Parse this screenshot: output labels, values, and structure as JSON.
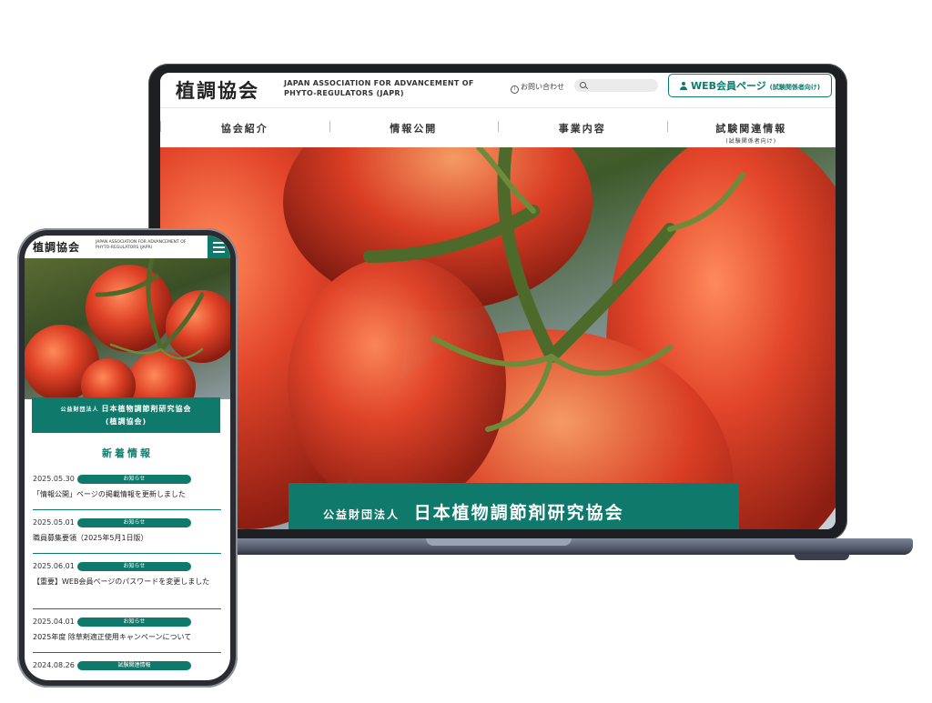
{
  "colors": {
    "accent": "#0f7a6c",
    "laptop_frame": "#1e1f22",
    "laptop_base": "#4a5162"
  },
  "desktop": {
    "logo_jp": "植調協会",
    "logo_en_line1": "JAPAN ASSOCIATION FOR ADVANCEMENT OF",
    "logo_en_line2": "PHYTO-REGULATORS (JAPR)",
    "contact_label": "お問い合わせ",
    "contact_icon": "info-circle-icon",
    "search_placeholder": "",
    "search_icon": "search-icon",
    "member_button_label": "WEB会員ページ",
    "member_button_sub": "(試験関係者向け)",
    "member_icon": "user-icon",
    "nav": [
      {
        "label": "協会紹介",
        "sub": ""
      },
      {
        "label": "情報公開",
        "sub": ""
      },
      {
        "label": "事業内容",
        "sub": ""
      },
      {
        "label": "試験関連情報",
        "sub": "(試験関係者向け)"
      }
    ],
    "hero_image": "tomatoes-on-vine",
    "banner_org": "公益財団法人",
    "banner_name": "日本植物調節剤研究協会"
  },
  "mobile": {
    "logo_jp": "植調協会",
    "logo_en_line1": "JAPAN ASSOCIATION FOR ADVANCEMENT OF",
    "logo_en_line2": "PHYTO-REGULATORS (JAPR)",
    "menu_icon": "hamburger-menu-icon",
    "hero_image": "tomatoes-on-vine",
    "banner_line1_org": "公益財団法人",
    "banner_line1_name": "日本植物調節剤研究協会",
    "banner_line2": "(植調協会)",
    "news_title": "新着情報",
    "news": [
      {
        "date": "2025.05.30",
        "tag": "お知らせ",
        "text": "「情報公開」ページの掲載情報を更新しました"
      },
      {
        "date": "2025.05.01",
        "tag": "お知らせ",
        "text": "職員募集要領（2025年5月1日版）"
      },
      {
        "date": "2025.06.01",
        "tag": "お知らせ",
        "text": "【重要】WEB会員ページのパスワードを変更しました"
      },
      {
        "date": "2025.04.01",
        "tag": "お知らせ",
        "text": "2025年度 除草剤適正使用キャンペーンについて"
      },
      {
        "date": "2024.08.26",
        "tag": "試験関連情報",
        "text": ""
      }
    ]
  }
}
